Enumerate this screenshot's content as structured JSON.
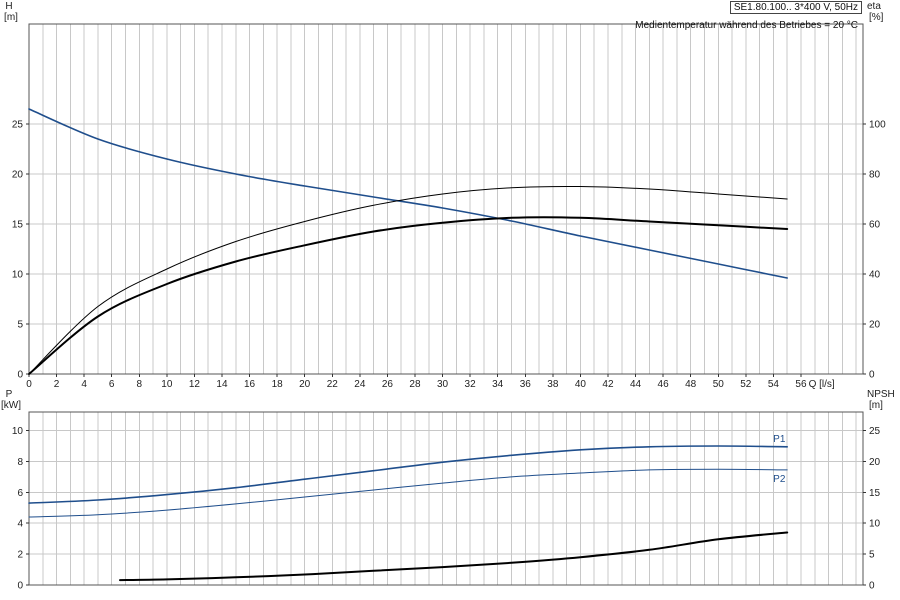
{
  "info": {
    "pump": "SE1.80.100.. 3*400 V, 50Hz",
    "medium": "Medientemperatur während des Betriebes = 20 °C"
  },
  "chart_data": [
    {
      "type": "line",
      "title": "",
      "x_label": "Q [l/s]",
      "x_range": [
        0,
        60.5
      ],
      "x_ticks": [
        0,
        2,
        4,
        6,
        8,
        10,
        12,
        14,
        16,
        18,
        20,
        22,
        24,
        26,
        28,
        30,
        32,
        34,
        36,
        38,
        40,
        42,
        44,
        46,
        48,
        50,
        52,
        54,
        56
      ],
      "left_axis": {
        "label_top": "H",
        "label_unit": "[m]",
        "range": [
          0,
          35
        ],
        "ticks": [
          0,
          5,
          10,
          15,
          20,
          25
        ]
      },
      "right_axis": {
        "label_top": "eta",
        "label_unit": "[%]",
        "range": [
          0,
          140
        ],
        "ticks": [
          0,
          20,
          40,
          60,
          80,
          100
        ]
      },
      "grid": true,
      "series": [
        {
          "name": "",
          "axis": "left",
          "color": "#1f4e8c",
          "width": 1.6,
          "x": [
            0,
            5,
            10,
            15,
            20,
            25,
            30,
            35,
            40,
            45,
            50,
            55
          ],
          "y": [
            26.5,
            23.5,
            21.5,
            20.0,
            18.8,
            17.7,
            16.6,
            15.3,
            13.8,
            12.4,
            11.0,
            9.6
          ]
        },
        {
          "name": "",
          "axis": "right",
          "color": "#000000",
          "width": 1.0,
          "x": [
            0,
            5,
            10,
            15,
            20,
            25,
            30,
            35,
            40,
            45,
            50,
            55
          ],
          "y": [
            0,
            27,
            42,
            53,
            61,
            67.5,
            72,
            74.5,
            75,
            74,
            72,
            70
          ]
        },
        {
          "name": "",
          "axis": "right",
          "color": "#000000",
          "width": 2.0,
          "x": [
            0,
            5,
            10,
            15,
            20,
            25,
            30,
            35,
            40,
            45,
            50,
            55
          ],
          "y": [
            0,
            23,
            36,
            45,
            51.5,
            57,
            60.5,
            62.5,
            62.5,
            61,
            59.5,
            58
          ]
        }
      ]
    },
    {
      "type": "line",
      "title": "",
      "x_range": [
        0,
        60.5
      ],
      "left_axis": {
        "label_top": "P",
        "label_unit": "[kW]",
        "range": [
          0,
          11.2
        ],
        "ticks": [
          0,
          2,
          4,
          6,
          8,
          10
        ]
      },
      "right_axis": {
        "label_top": "NPSH",
        "label_unit": "[m]",
        "range": [
          0,
          28
        ],
        "ticks": [
          0,
          5,
          10,
          15,
          20,
          25
        ]
      },
      "grid": true,
      "series": [
        {
          "name": "P1",
          "axis": "left",
          "color": "#1f4e8c",
          "width": 1.6,
          "x": [
            0,
            5,
            10,
            15,
            20,
            25,
            30,
            35,
            40,
            45,
            50,
            55
          ],
          "y": [
            5.3,
            5.5,
            5.85,
            6.3,
            6.85,
            7.4,
            7.95,
            8.4,
            8.75,
            8.95,
            9.0,
            8.95
          ]
        },
        {
          "name": "P2",
          "axis": "left",
          "color": "#1f4e8c",
          "width": 1.0,
          "x": [
            0,
            5,
            10,
            15,
            20,
            25,
            30,
            35,
            40,
            45,
            50,
            55
          ],
          "y": [
            4.4,
            4.55,
            4.85,
            5.25,
            5.7,
            6.15,
            6.6,
            7.0,
            7.25,
            7.45,
            7.5,
            7.45
          ]
        },
        {
          "name": "",
          "axis": "right",
          "color": "#000000",
          "width": 2.0,
          "x": [
            6.6,
            10,
            15,
            20,
            25,
            30,
            35,
            40,
            45,
            50,
            55
          ],
          "y": [
            0.8,
            0.9,
            1.25,
            1.7,
            2.3,
            2.9,
            3.6,
            4.5,
            5.7,
            7.4,
            8.5
          ]
        }
      ]
    }
  ]
}
